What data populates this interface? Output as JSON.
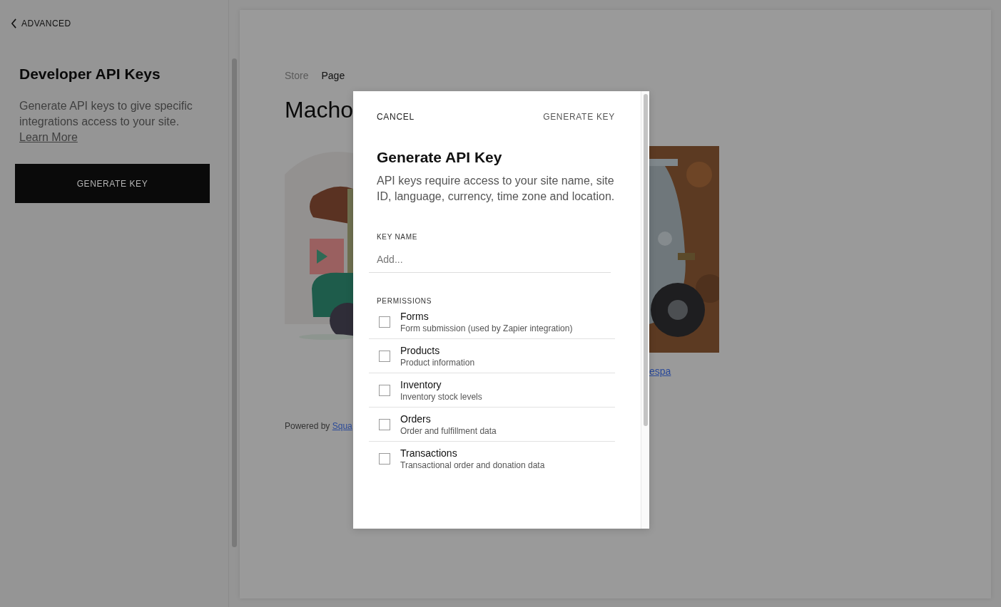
{
  "sidebar": {
    "back_link": "ADVANCED",
    "title": "Developer API Keys",
    "description": "Generate API keys to give specific integrations access to your site.",
    "learn_more": "Learn More",
    "button": "GENERATE KEY"
  },
  "preview": {
    "breadcrumbs": [
      "Store",
      "Page"
    ],
    "title": "Macho",
    "right_link": "espa",
    "footer_text": "Powered by",
    "footer_link": "Squa"
  },
  "dialog": {
    "cancel": "CANCEL",
    "confirm": "GENERATE KEY",
    "title": "Generate API Key",
    "description": "API keys require access to your site name, site ID, language, currency, time zone and location.",
    "key_name": {
      "label": "KEY NAME",
      "placeholder": "Add..."
    },
    "permissions_label": "PERMISSIONS",
    "permissions": [
      {
        "name": "Forms",
        "description": "Form submission (used by Zapier integration)",
        "checked": false
      },
      {
        "name": "Products",
        "description": "Product information",
        "checked": false
      },
      {
        "name": "Inventory",
        "description": "Inventory stock levels",
        "checked": false
      },
      {
        "name": "Orders",
        "description": "Order and fulfillment data",
        "checked": false
      },
      {
        "name": "Transactions",
        "description": "Transactional order and donation data",
        "checked": false
      }
    ]
  }
}
